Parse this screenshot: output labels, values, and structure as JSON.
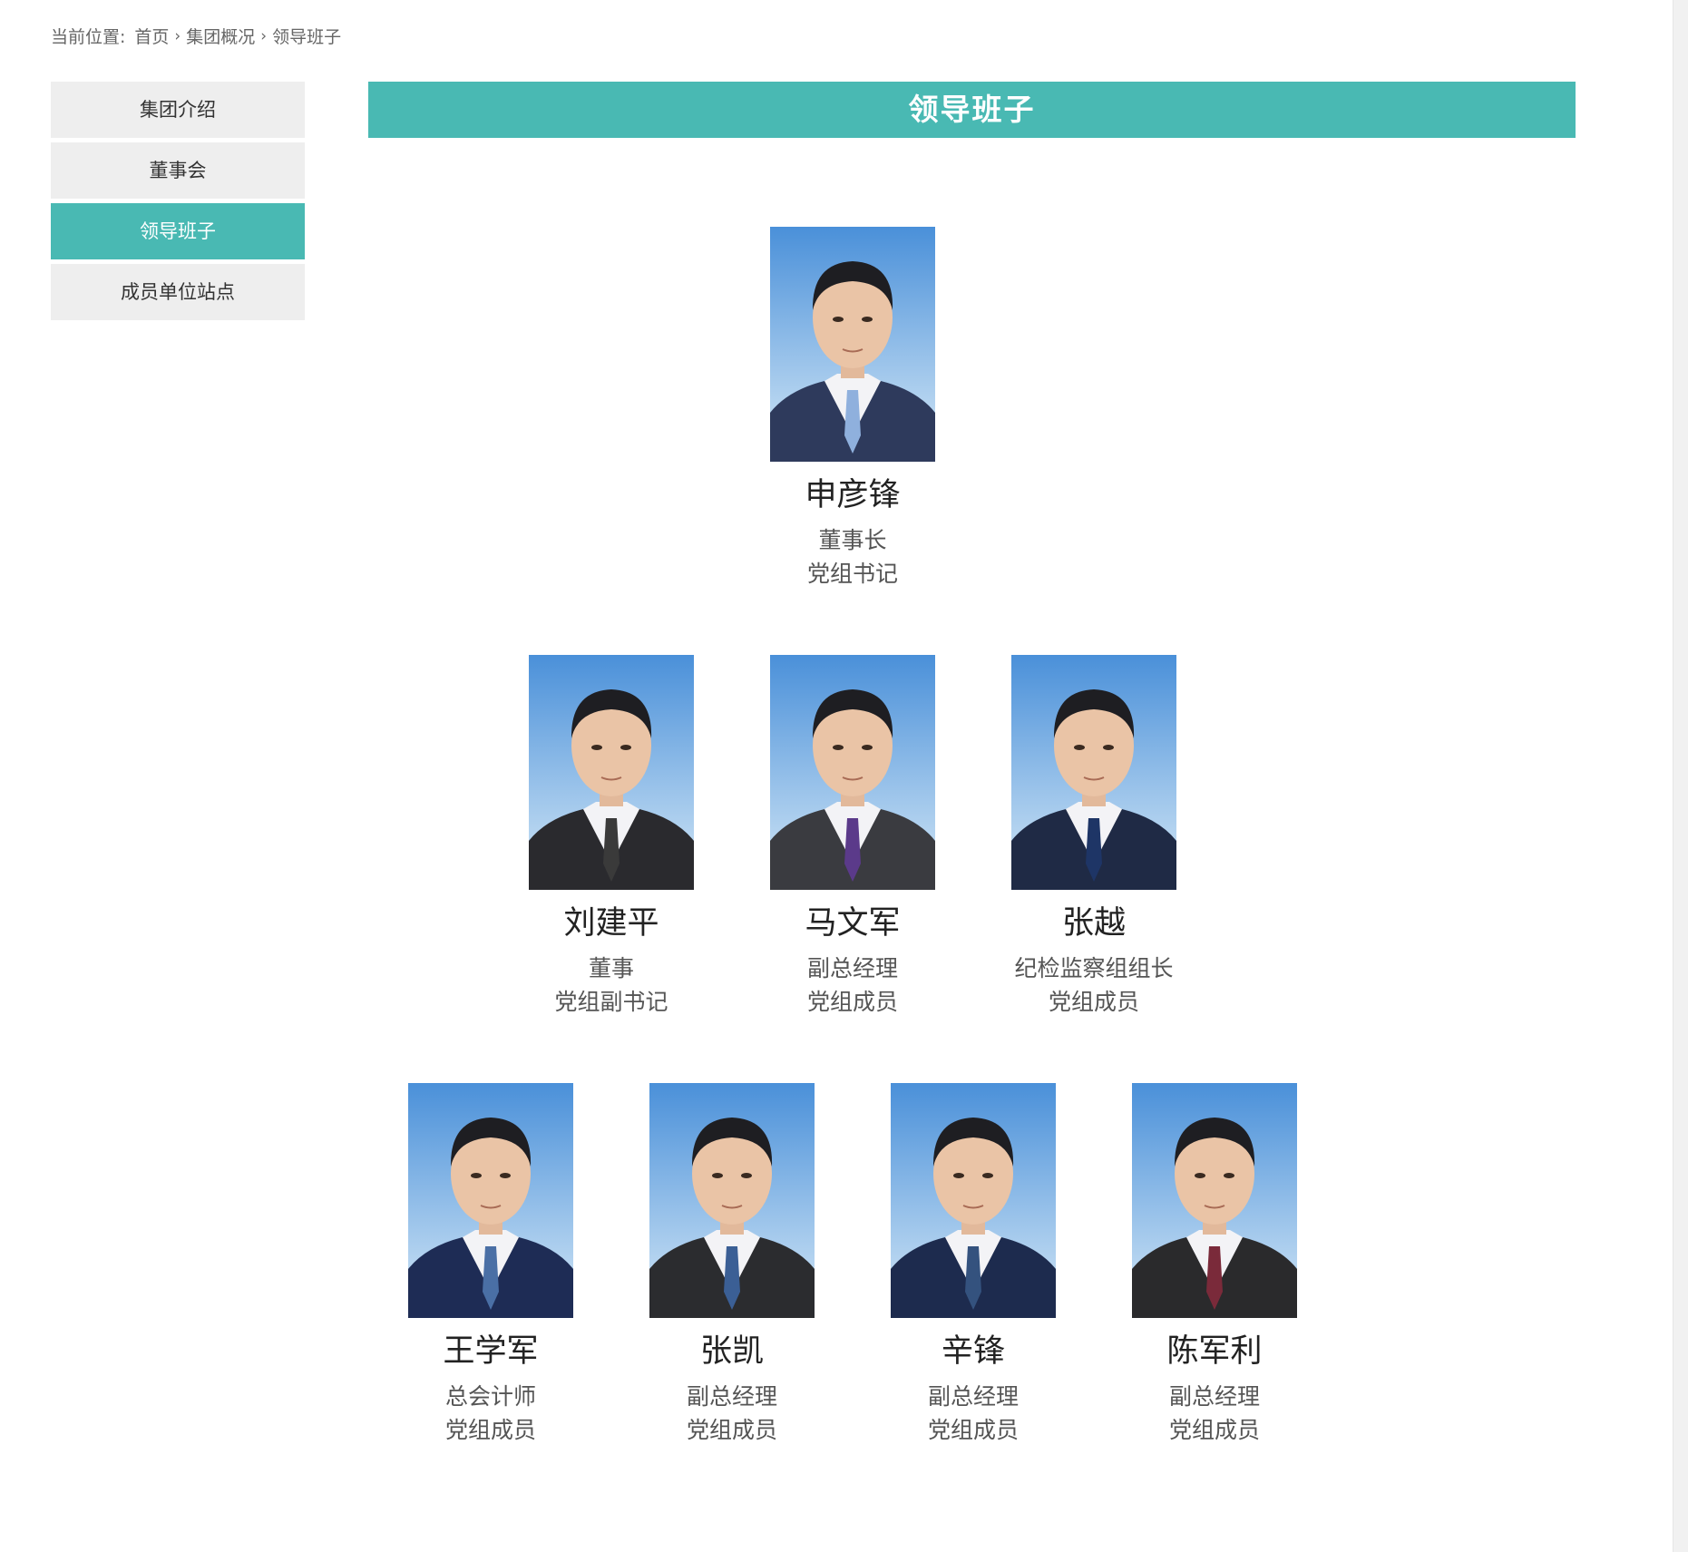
{
  "breadcrumb": {
    "prefix": "当前位置:",
    "items": [
      "首页",
      "集团概况",
      "领导班子"
    ]
  },
  "sidebar": {
    "items": [
      {
        "label": "集团介绍",
        "active": false
      },
      {
        "label": "董事会",
        "active": false
      },
      {
        "label": "领导班子",
        "active": true
      },
      {
        "label": "成员单位站点",
        "active": false
      }
    ]
  },
  "main": {
    "title": "领导班子"
  },
  "leaders": [
    {
      "name": "申彦锋",
      "titles": [
        "董事长",
        "党组书记"
      ]
    },
    {
      "name": "刘建平",
      "titles": [
        "董事",
        "党组副书记"
      ]
    },
    {
      "name": "马文军",
      "titles": [
        "副总经理",
        "党组成员"
      ]
    },
    {
      "name": "张越",
      "titles": [
        "纪检监察组组长",
        "党组成员"
      ]
    },
    {
      "name": "王学军",
      "titles": [
        "总会计师",
        "党组成员"
      ]
    },
    {
      "name": "张凯",
      "titles": [
        "副总经理",
        "党组成员"
      ]
    },
    {
      "name": "辛锋",
      "titles": [
        "副总经理",
        "党组成员"
      ]
    },
    {
      "name": "陈军利",
      "titles": [
        "副总经理",
        "党组成员"
      ]
    }
  ],
  "colors": {
    "accent": "#49b9b3",
    "sidebar_bg": "#eeeeee",
    "photo_bg_top": "#4a90d9",
    "photo_bg_bottom": "#d6e9f7"
  }
}
